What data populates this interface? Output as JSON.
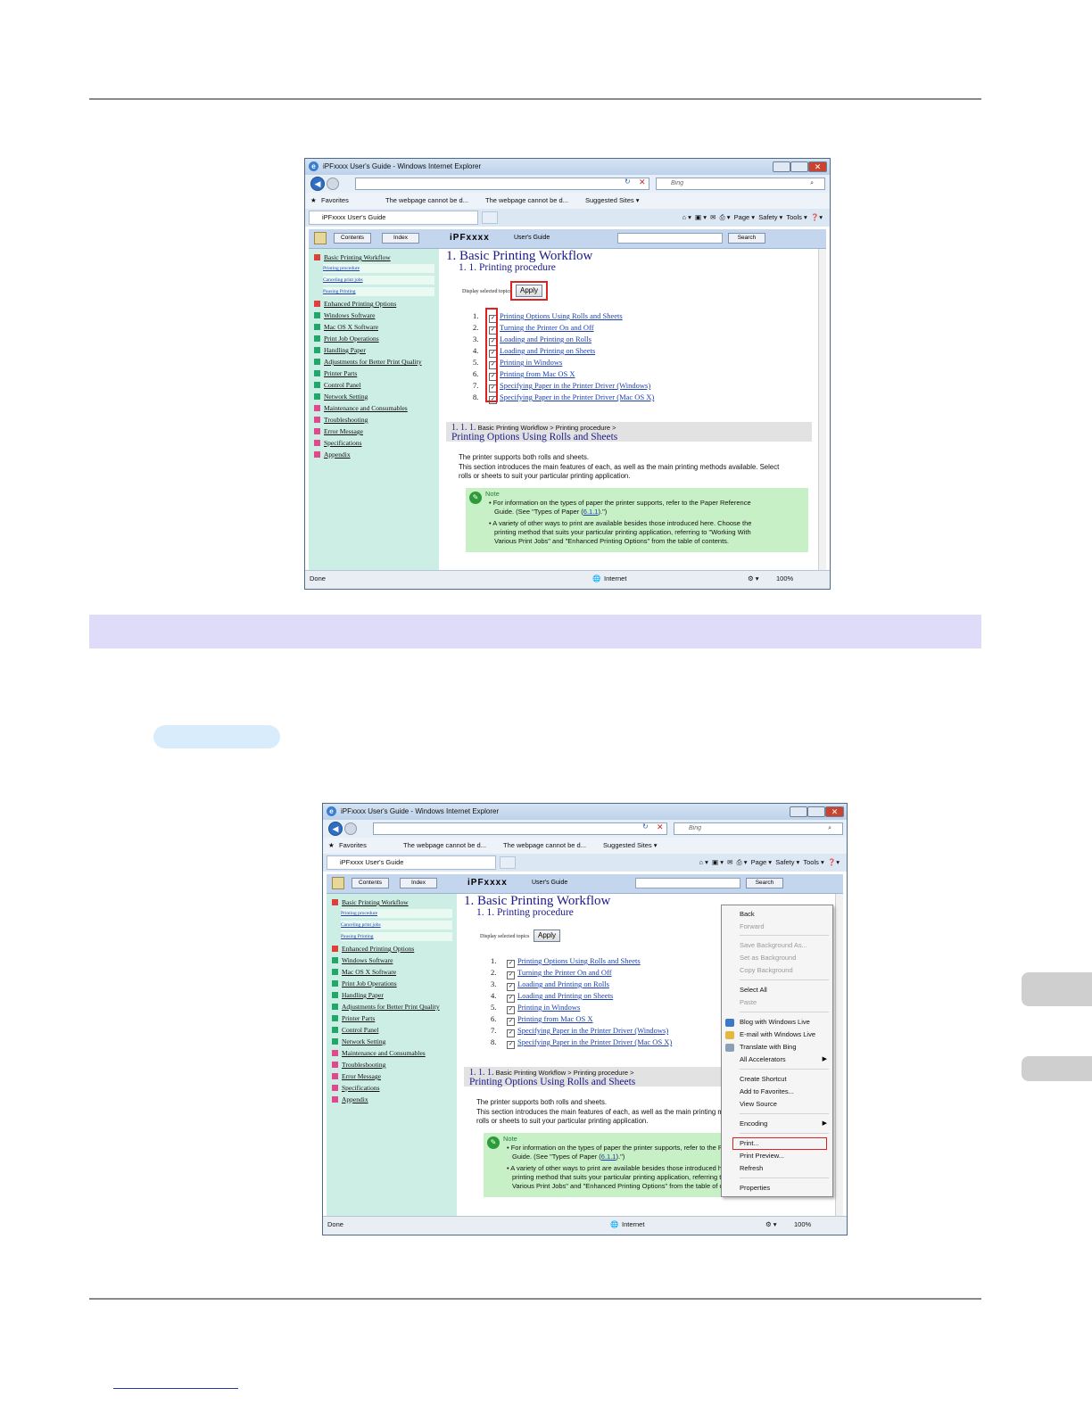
{
  "window": {
    "title": "iPFxxxx User's Guide - Windows Internet Explorer",
    "address_url": "",
    "search_placeholder": "Bing",
    "favorites": {
      "favorites_label": "Favorites",
      "fav1": "The webpage cannot be d...",
      "fav2": "The webpage cannot be d...",
      "suggested": "Suggested Sites ▾"
    },
    "tab_label": "iPFxxxx User's Guide",
    "commands": {
      "page": "Page ▾",
      "safety": "Safety ▾",
      "tools": "Tools ▾"
    },
    "status": {
      "text": "Done",
      "zone": "Internet",
      "zoom": "100%"
    }
  },
  "help": {
    "contents_btn": "Contents",
    "index_btn": "Index",
    "brand": "iPFxxxx",
    "users_guide": "User's Guide",
    "search_btn": "Search"
  },
  "sidebar": {
    "items": [
      "Basic Printing Workflow",
      "Enhanced Printing Options",
      "Windows Software",
      "Mac OS X Software",
      "Print Job Operations",
      "Handling Paper",
      "Adjustments for Better Print Quality",
      "Printer Parts",
      "Control Panel",
      "Network Setting",
      "Maintenance and Consumables",
      "Troubleshooting",
      "Error Message",
      "Specifications",
      "Appendix"
    ],
    "subitems": [
      "Printing procedure",
      "Canceling print jobs",
      "Pausing Printing"
    ],
    "colors": {
      "red": "#e0403a",
      "green": "#1fa86a",
      "pink": "#e04a8c"
    }
  },
  "content": {
    "h1": "1. Basic Printing Workflow",
    "h2": "1. 1. Printing procedure",
    "display_selected": "Display selected topics",
    "apply": "Apply",
    "topics": [
      {
        "n": "1.",
        "t": "Printing Options Using Rolls and Sheets"
      },
      {
        "n": "2.",
        "t": "Turning the Printer On and Off"
      },
      {
        "n": "3.",
        "t": "Loading and Printing on Rolls"
      },
      {
        "n": "4.",
        "t": "Loading and Printing on Sheets"
      },
      {
        "n": "5.",
        "t": "Printing in Windows"
      },
      {
        "n": "6.",
        "t": "Printing from Mac OS X"
      },
      {
        "n": "7.",
        "t": "Specifying Paper in the Printer Driver (Windows)"
      },
      {
        "n": "8.",
        "t": "Specifying Paper in the Printer Driver (Mac OS X)"
      }
    ],
    "section_num": "1. 1. 1.",
    "section_crumb": " Basic Printing Workflow > Printing procedure >",
    "section_title": "Printing Options Using Rolls and Sheets",
    "body1": "The printer supports both rolls and sheets.",
    "body2": "This section introduces the main features of each, as well as the main printing methods available. Select",
    "body3": "rolls or sheets to suit your particular printing application.",
    "note_label": "Note",
    "note1a": "• For information on the types of paper the printer supports, refer to the Paper Reference",
    "note1b_pre": "Guide.  (See \"Types of Paper (",
    "note1b_link": "6.1.1",
    "note1b_post": ").\")",
    "note2a": "• A variety of other ways to print are available besides those introduced here. Choose the",
    "note2b": "printing method that suits your particular printing application, referring to \"Working With",
    "note2c": "Various Print Jobs\" and \"Enhanced Printing Options\" from the table of contents."
  },
  "context_menu": {
    "items": [
      "Back",
      "Forward",
      "Save Background As...",
      "Set as Background",
      "Copy Background",
      "Select All",
      "Paste",
      "Blog with Windows Live",
      "E-mail with Windows Live",
      "Translate with Bing",
      "All Accelerators",
      "Create Shortcut",
      "Add to Favorites...",
      "View Source",
      "Encoding",
      "Print...",
      "Print Preview...",
      "Refresh",
      "Properties"
    ]
  }
}
